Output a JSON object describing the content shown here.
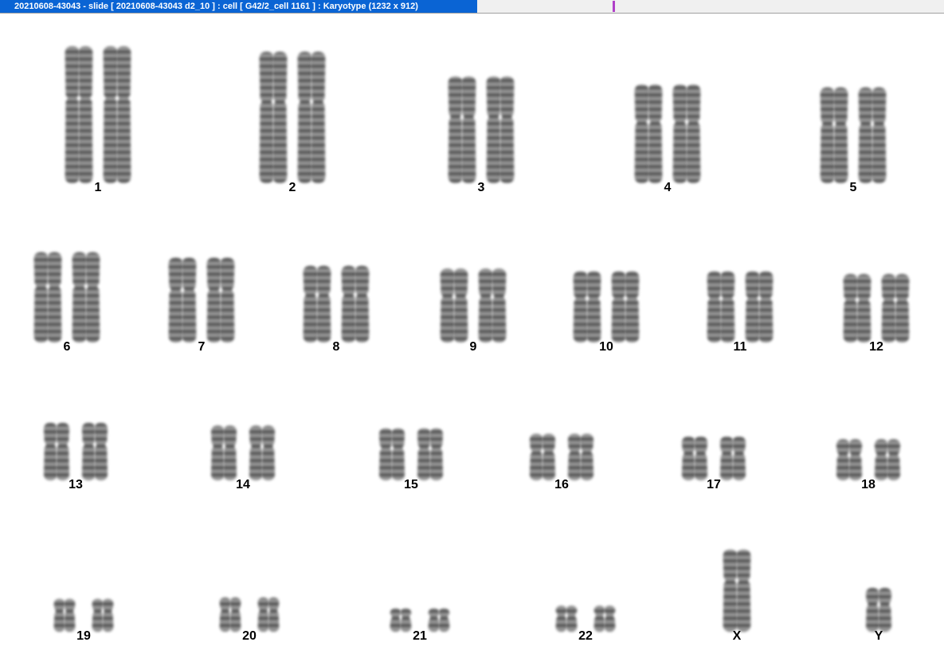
{
  "window": {
    "title": "20210608-43043 - slide [ 20210608-43043 d2_10 ] : cell [ G42/2_cell 1161 ] : Karyotype  (1232 x 912)"
  },
  "karyotype": {
    "pairs": [
      {
        "label": "1",
        "size": 1.0
      },
      {
        "label": "2",
        "size": 0.96
      },
      {
        "label": "3",
        "size": 0.78
      },
      {
        "label": "4",
        "size": 0.72
      },
      {
        "label": "5",
        "size": 0.7
      },
      {
        "label": "6",
        "size": 0.66
      },
      {
        "label": "7",
        "size": 0.62
      },
      {
        "label": "8",
        "size": 0.56
      },
      {
        "label": "9",
        "size": 0.54
      },
      {
        "label": "10",
        "size": 0.52
      },
      {
        "label": "11",
        "size": 0.52
      },
      {
        "label": "12",
        "size": 0.5
      },
      {
        "label": "13",
        "size": 0.42
      },
      {
        "label": "14",
        "size": 0.4
      },
      {
        "label": "15",
        "size": 0.38
      },
      {
        "label": "16",
        "size": 0.34
      },
      {
        "label": "17",
        "size": 0.32
      },
      {
        "label": "18",
        "size": 0.3
      },
      {
        "label": "19",
        "size": 0.24
      },
      {
        "label": "20",
        "size": 0.25
      },
      {
        "label": "21",
        "size": 0.17
      },
      {
        "label": "22",
        "size": 0.19
      },
      {
        "label": "X",
        "size": 0.6,
        "single": true
      },
      {
        "label": "Y",
        "size": 0.32,
        "single": true
      }
    ]
  }
}
